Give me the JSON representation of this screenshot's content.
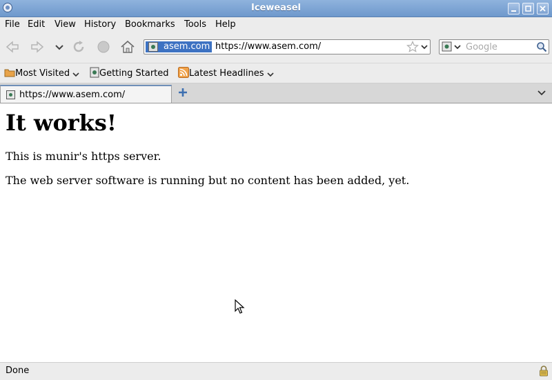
{
  "window": {
    "title": "Iceweasel"
  },
  "menu": {
    "items": [
      {
        "label": "File"
      },
      {
        "label": "Edit"
      },
      {
        "label": "View"
      },
      {
        "label": "History"
      },
      {
        "label": "Bookmarks"
      },
      {
        "label": "Tools"
      },
      {
        "label": "Help"
      }
    ]
  },
  "navigation": {
    "back_icon": "back-arrow-icon",
    "forward_icon": "forward-arrow-icon",
    "history_dropdown_icon": "chevron-down-icon",
    "reload_icon": "reload-icon",
    "stop_icon": "stop-icon",
    "home_icon": "home-icon"
  },
  "urlbar": {
    "identity_label": "asem.com",
    "url": "https://www.asem.com/",
    "bookmark_icon": "star-icon"
  },
  "search": {
    "placeholder": "Google",
    "engine_icon": "search-engine-icon",
    "go_icon": "magnifier-icon"
  },
  "bookmarks_toolbar": {
    "items": [
      {
        "label": "Most Visited",
        "icon": "folder-icon"
      },
      {
        "label": "Getting Started",
        "icon": "page-icon"
      },
      {
        "label": "Latest Headlines",
        "icon": "rss-feed-icon"
      }
    ]
  },
  "tabs": [
    {
      "label": "https://www.asem.com/"
    }
  ],
  "page": {
    "heading": "It works!",
    "paragraphs": [
      "This is munir's https server.",
      "The web server software is running but no content has been added, yet."
    ]
  },
  "status": {
    "text": "Done",
    "security_icon": "lock-icon"
  },
  "colors": {
    "title_bar": "#7aa2d4",
    "identity_highlight": "#3d72c2",
    "chrome": "#ececec"
  }
}
